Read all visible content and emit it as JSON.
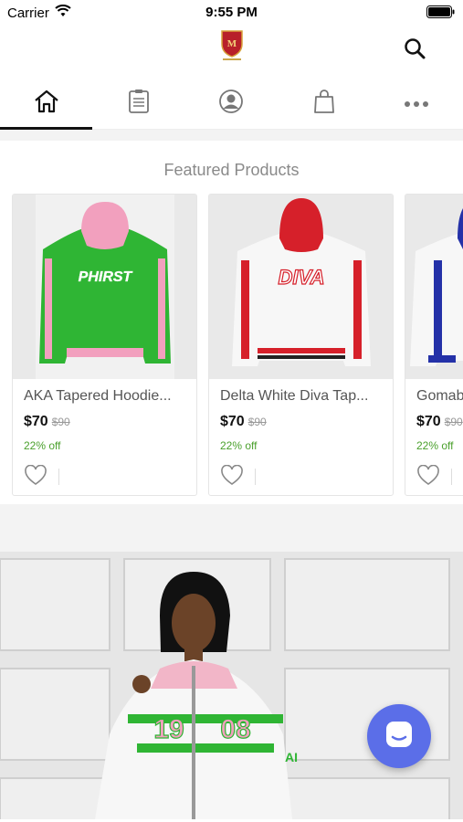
{
  "status": {
    "carrier": "Carrier",
    "time": "9:55 PM"
  },
  "header": {
    "logo_icon": "crest-logo-icon",
    "search_icon": "search-icon"
  },
  "tabs": [
    {
      "icon": "home-icon",
      "active": true
    },
    {
      "icon": "clipboard-icon",
      "active": false
    },
    {
      "icon": "account-icon",
      "active": false
    },
    {
      "icon": "shopping-bag-icon",
      "active": false
    },
    {
      "icon": "more-icon",
      "active": false
    }
  ],
  "section": {
    "title": "Featured Products"
  },
  "products": [
    {
      "name": "AKA Tapered Hoodie...",
      "price": "$70",
      "old_price": "$90",
      "discount": "22% off",
      "colors": {
        "body": "#2fb534",
        "hood": "#f2a0be",
        "text": "PHIRST"
      }
    },
    {
      "name": "Delta White Diva Tap...",
      "price": "$70",
      "old_price": "$90",
      "discount": "22% off",
      "colors": {
        "body": "#f5f5f5",
        "hood": "#d6202a",
        "text": "DIVA"
      }
    },
    {
      "name": "Gomab",
      "price": "$70",
      "old_price": "$90",
      "discount": "22% off",
      "colors": {
        "body": "#f5f5f5",
        "hood": "#2431a8",
        "text": ""
      }
    }
  ],
  "banner": {
    "jacket_text": "1908",
    "sleeve_text": "AI"
  },
  "fab": {
    "icon": "chat-icon"
  },
  "theme": {
    "accent": "#5b6ee8",
    "green": "#4aa02c"
  }
}
